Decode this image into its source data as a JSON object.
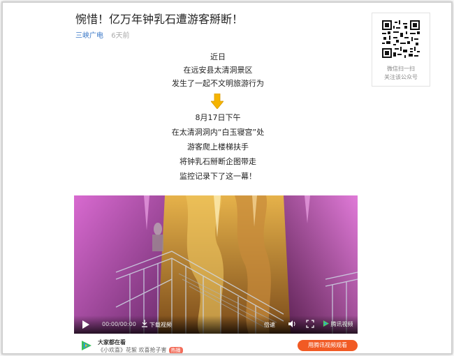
{
  "article": {
    "title": "惋惜！亿万年钟乳石遭游客掰断！",
    "source": "三峡广电",
    "time": "6天前"
  },
  "intro_lines": [
    "近日",
    "在远安县太清洞景区",
    "发生了一起不文明旅游行为"
  ],
  "detail_lines": [
    "8月17日下午",
    "在太清洞洞内“白玉寝宫”处",
    "游客爬上楼梯扶手",
    "将钟乳石掰断企图带走",
    "监控记录下了这一幕！"
  ],
  "qr": {
    "caption_line1": "微信扫一扫",
    "caption_line2": "关注该公众号"
  },
  "video": {
    "time": "00:00/00:00",
    "download_label": "下载视频",
    "speed_label": "倍速",
    "brand_label": "腾讯视频"
  },
  "reco": {
    "label": "大家都在看",
    "item": "《小欢喜》花絮 欢喜抢子害",
    "badge": "热播",
    "watch_label": "用腾讯视频观看"
  },
  "colors": {
    "source_link": "#3a78c7",
    "arrow": "#f5b400",
    "watch_button": "#f15a24"
  },
  "icons": [
    "arrow-down-icon",
    "qr-code-icon",
    "play-icon",
    "download-icon",
    "volume-icon",
    "fullscreen-icon",
    "tencent-video-icon"
  ]
}
